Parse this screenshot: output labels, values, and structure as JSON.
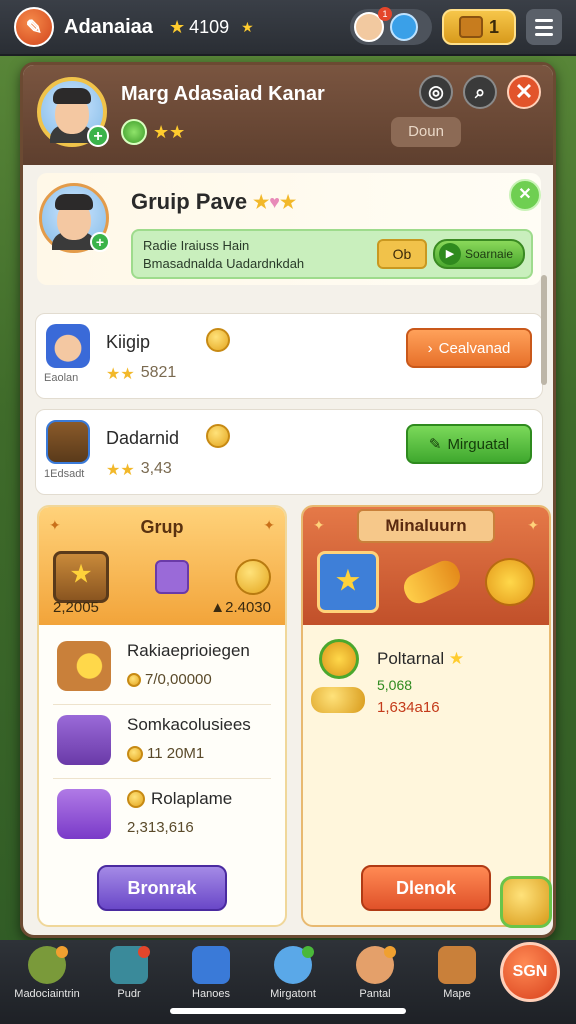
{
  "topbar": {
    "title": "Adanaiaa",
    "stat_value": "4109",
    "avatar_badge": "1",
    "counter_value": "1",
    "icons": [
      "logo-icon",
      "star-icon",
      "avatar-icon",
      "info-disc-icon",
      "chest-icon",
      "menu-icon"
    ]
  },
  "header": {
    "name": "Marg Adasaiad Kanar",
    "rating_text": "★★",
    "action_label": "Doun",
    "close_glyph": "✕"
  },
  "group": {
    "title": "Gruip Pave",
    "info_line1": "Radie Iraiuss Hain",
    "info_line2": "Bmasadnalda Uadardnkdah",
    "ok_label": "Ob",
    "share_label": "Soarnaie"
  },
  "players": [
    {
      "name": "Kiigip",
      "sub": "Eaolan",
      "stars": "★★",
      "value": "5821",
      "button": "Cealvanad"
    },
    {
      "name": "Dadarnid",
      "sub": "1Edsadt",
      "stars": "★★",
      "value": "3,43",
      "button": "Mirguatal"
    }
  ],
  "left_column": {
    "title": "Grup",
    "value_a": "2,2005",
    "value_b": "▲2.4030",
    "rewards": [
      {
        "title": "Rakiaeprioiegen",
        "value": "7/0,00000"
      },
      {
        "title": "Somkacolusiees",
        "value": "11 20M1"
      },
      {
        "title": "Rolaplame",
        "value": "2,313,616"
      }
    ],
    "button": "Bronrak"
  },
  "right_column": {
    "title": "Minaluurn",
    "item_title": "Poltarnal",
    "item_v1": "5,068",
    "item_v2": "1,634a16",
    "button": "Dlenok"
  },
  "nav": {
    "items": [
      {
        "label": "Madociaintrin",
        "color": "#7a9a3a"
      },
      {
        "label": "Pudr",
        "color": "#3a8a9a"
      },
      {
        "label": "Hanoes",
        "color": "#3a7ad8"
      },
      {
        "label": "Mirgatont",
        "color": "#5aa8e8"
      },
      {
        "label": "Pantal",
        "color": "#e4a06a"
      },
      {
        "label": "Mape",
        "color": "#c9803a"
      }
    ],
    "big_button": "SGN"
  },
  "colors": {
    "accent_orange": "#e7702a",
    "accent_green": "#3fa82e",
    "accent_purple": "#6a48c8",
    "panel_brown": "#6b4a32"
  }
}
